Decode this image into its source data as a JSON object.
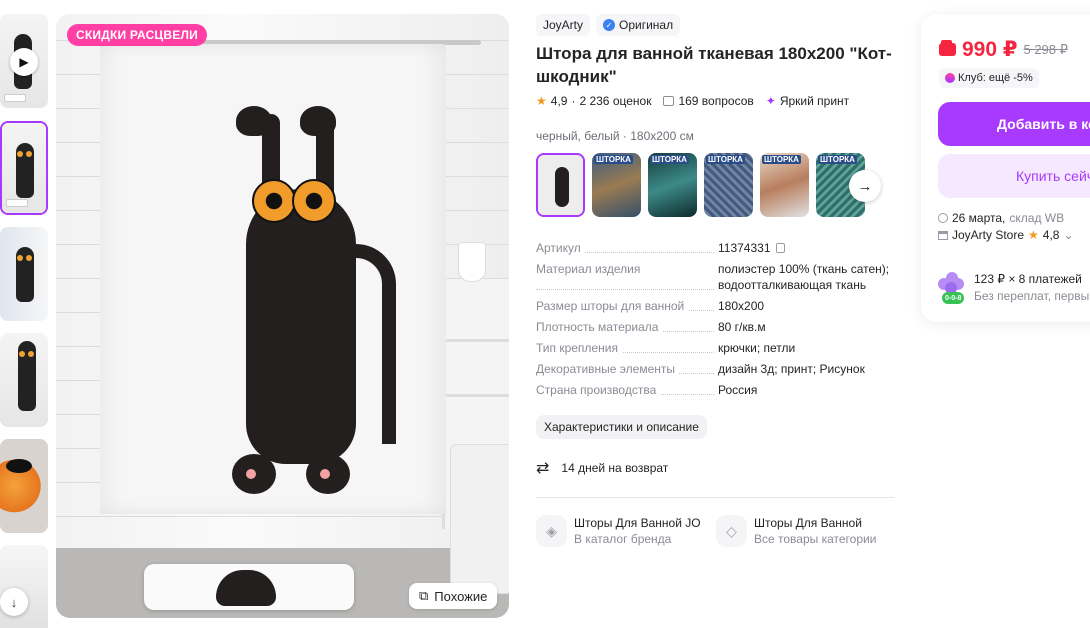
{
  "gallery": {
    "sale_badge": "СКИДКИ РАСЦВЕЛИ",
    "similar_label": "Похожие",
    "thumbnails": [
      "video",
      "cat-curtain",
      "cat-curtain-bathroom",
      "cat-curtain-closeup",
      "cat-eye-closeup",
      "white-detail"
    ]
  },
  "product": {
    "brand": "JoyArty",
    "original_label": "Оригинал",
    "title": "Штора для ванной тканевая 180х200 \"Кот-шкодник\"",
    "rating": "4,9",
    "reviews": "2 236 оценок",
    "questions": "169 вопросов",
    "feature": "Яркий принт",
    "variant_label": "черный, белый · 180х200 см",
    "variant_tag": "ШТОРКА",
    "specs": [
      {
        "key": "Артикул",
        "value": "11374331"
      },
      {
        "key": "Материал изделия",
        "value": "полиэстер 100% (ткань сатен); водоотталкивающая ткань"
      },
      {
        "key": "Размер шторы для ванной",
        "value": "180х200"
      },
      {
        "key": "Плотность материала",
        "value": "80 г/кв.м"
      },
      {
        "key": "Тип крепления",
        "value": "крючки; петли"
      },
      {
        "key": "Декоративные элементы",
        "value": "дизайн 3д; принт; Рисунок"
      },
      {
        "key": "Страна производства",
        "value": "Россия"
      }
    ],
    "chars_button": "Характеристики и описание",
    "return_text": "14 дней на возврат",
    "links": [
      {
        "title": "Шторы Для Ванной JOYARTY",
        "subtitle": "В каталог бренда"
      },
      {
        "title": "Шторы Для Ванной",
        "subtitle": "Все товары категории"
      }
    ]
  },
  "purchase": {
    "price": "990 ₽",
    "old_price": "5 298 ₽",
    "club": "Клуб: ещё -5%",
    "add_to_cart": "Добавить в корзину",
    "buy_now": "Купить сейчас",
    "delivery_date": "26 марта,",
    "delivery_from": "склад WB",
    "store_name": "JoyArty Store",
    "store_rating": "4,8",
    "installment": "123 ₽ × 8 платежей",
    "installment_note": "Без переплат, первый платёж",
    "installment_badge": "0-0-8"
  },
  "colors": {
    "accent": "#a73afd",
    "price": "#f5253f",
    "sale_badge": "#ff3fa4"
  }
}
